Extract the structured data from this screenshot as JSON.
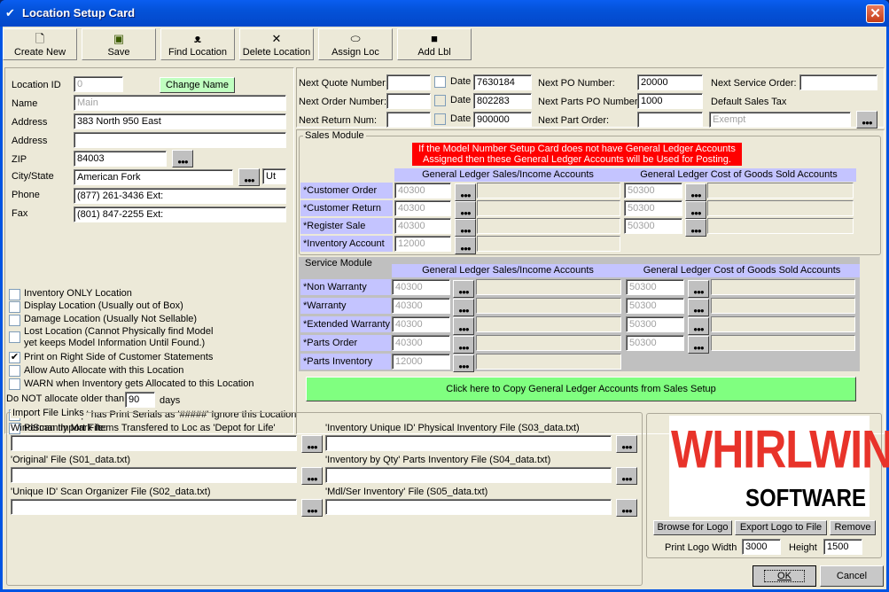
{
  "window": {
    "title": "Location Setup Card",
    "close_icon": "close-icon"
  },
  "toolbar": [
    {
      "label": "Create New",
      "icon": "new-document-icon",
      "glyph": "🗋"
    },
    {
      "label": "Save",
      "icon": "floppy-disk-icon",
      "glyph": "💾"
    },
    {
      "label": "Find Location",
      "icon": "binoculars-icon",
      "glyph": "⚲"
    },
    {
      "label": "Delete Location",
      "icon": "x-delete-icon",
      "glyph": "✕"
    },
    {
      "label": "Assign Loc",
      "icon": "ellipse-icon",
      "glyph": "⬭"
    },
    {
      "label": "Add Lbl",
      "icon": "label-icon",
      "glyph": "■"
    }
  ],
  "location": {
    "id_label": "Location ID",
    "id_value": "0",
    "change_name_label": "Change Name",
    "name_label": "Name",
    "name_value": "Main",
    "address_label": "Address",
    "address1": "383 North 950 East",
    "address2_label": "Address",
    "address2": "",
    "zip_label": "ZIP",
    "zip": "84003",
    "city_label": "City/State",
    "city": "American Fork",
    "state": "Ut",
    "phone_label": "Phone",
    "phone": "(877) 261-3436 Ext:",
    "fax_label": "Fax",
    "fax": "(801) 847-2255 Ext:"
  },
  "options": [
    {
      "label": "Inventory ONLY Location",
      "checked": false
    },
    {
      "label": "Display Location (Usually out of Box)",
      "checked": false
    },
    {
      "label": "Damage Location (Usually Not Sellable)",
      "checked": false
    },
    {
      "label": "Lost Location (Cannot Physically find Model",
      "label2": "yet keeps Model Information Until Found.)",
      "checked": false
    },
    {
      "label": "Print on Right Side of Customer Statements",
      "checked": true
    },
    {
      "label": "Allow Auto Allocate with this Location",
      "checked": false
    },
    {
      "label": "WARN when Inventory gets Allocated to this Location",
      "checked": false
    }
  ],
  "allocate": {
    "label": "Do NOT allocate older than",
    "value": "90",
    "unit": "days"
  },
  "options2": [
    {
      "label": "If 'Sales Setup' has Print Serials as '#####' Ignore this Location",
      "checked": false
    },
    {
      "label": "Permantly Mark Items Transfered to Loc as 'Depot for Life'",
      "checked": false
    }
  ],
  "numbers": {
    "quote_label": "Next Quote Number:",
    "quote_value": "",
    "quote_date_label": "Date",
    "quote_date": "7630184",
    "order_label": "Next Order Number:",
    "order_value": "",
    "order_date_label": "Date",
    "order_date": "802283",
    "return_label": "Next Return Num:",
    "return_value": "",
    "return_date_label": "Date",
    "return_date": "900000",
    "po_label": "Next PO Number:",
    "po_value": "20000",
    "parts_po_label": "Next Parts PO Number:",
    "parts_po_value": "1000",
    "part_order_label": "Next Part Order:",
    "part_order_value": "",
    "service_label": "Next Service Order:",
    "service_value": "",
    "tax_label": "Default Sales Tax",
    "tax_value": "Exempt"
  },
  "sales": {
    "title": "Sales Module",
    "warning_line1": "If the Model Number Setup Card does not have General Ledger Accounts",
    "warning_line2": "Assigned then these General Ledger Accounts will be Used for Posting.",
    "income_header": "General Ledger Sales/Income Accounts",
    "cogs_header": "General Ledger Cost of Goods Sold Accounts",
    "rows": [
      {
        "label": "*Customer Order",
        "income": "40300",
        "cogs": "50300"
      },
      {
        "label": "*Customer Return",
        "income": "40300",
        "cogs": "50300"
      },
      {
        "label": "*Register Sale",
        "income": "40300",
        "cogs": "50300"
      },
      {
        "label": "*Inventory Account",
        "income": "12000"
      }
    ]
  },
  "service": {
    "title": "Service Module",
    "income_header": "General Ledger Sales/Income Accounts",
    "cogs_header": "General Ledger Cost of Goods Sold Accounts",
    "rows": [
      {
        "label": "*Non Warranty",
        "income": "40300",
        "cogs": "50300"
      },
      {
        "label": "*Warranty",
        "income": "40300",
        "cogs": "50300"
      },
      {
        "label": "*Extended Warranty",
        "income": "40300",
        "cogs": "50300"
      },
      {
        "label": "*Parts Order",
        "income": "40300",
        "cogs": "50300"
      },
      {
        "label": "*Parts Inventory",
        "income": "12000"
      }
    ]
  },
  "copy_button": "Click here to Copy General Ledger Accounts from Sales Setup",
  "imports": {
    "title": "Import File Links",
    "left": [
      {
        "label": "WindScan Import File:",
        "value": ""
      },
      {
        "label": "'Original' File  (S01_data.txt)",
        "value": ""
      },
      {
        "label": "'Unique ID' Scan Organizer File  (S02_data.txt)",
        "value": ""
      }
    ],
    "right": [
      {
        "label": "'Inventory Unique ID' Physical Inventory File  (S03_data.txt)",
        "value": ""
      },
      {
        "label": "'Inventory by Qty' Parts Inventory File  (S04_data.txt)",
        "value": ""
      },
      {
        "label": "'Mdl/Ser Inventory' File  (S05_data.txt)",
        "value": ""
      }
    ]
  },
  "logo": {
    "text_main": "WHIRLWIND",
    "text_sub": "SOFTWARE",
    "brand_color": "#e8332a",
    "browse": "Browse for Logo",
    "export": "Export Logo to File",
    "remove": "Remove",
    "width_label": "Print Logo Width",
    "width": "3000",
    "height_label": "Height",
    "height": "1500"
  },
  "dialog": {
    "ok": "OK",
    "cancel": "Cancel"
  },
  "colors": {
    "accent_green": "#80ff80",
    "warning_red": "#ff0000",
    "header_lavender": "#c4c4ff"
  }
}
